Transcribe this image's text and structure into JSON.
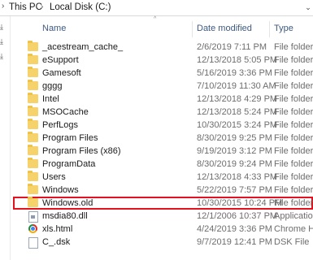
{
  "breadcrumb": {
    "items": [
      "This PC",
      "Local Disk (C:)"
    ]
  },
  "columns": {
    "name": "Name",
    "date": "Date modified",
    "type": "Type"
  },
  "rows": [
    {
      "name": "_acestream_cache_",
      "date": "2/6/2019 7:11 PM",
      "type": "File folder",
      "icon": "folder-icon"
    },
    {
      "name": "eSupport",
      "date": "12/13/2018 5:05 PM",
      "type": "File folder",
      "icon": "folder-icon"
    },
    {
      "name": "Gamesoft",
      "date": "5/16/2019 3:36 PM",
      "type": "File folder",
      "icon": "folder-icon"
    },
    {
      "name": "gggg",
      "date": "7/10/2019 11:30 AM",
      "type": "File folder",
      "icon": "folder-icon"
    },
    {
      "name": "Intel",
      "date": "12/13/2018 4:29 PM",
      "type": "File folder",
      "icon": "folder-icon"
    },
    {
      "name": "MSOCache",
      "date": "12/13/2018 5:24 PM",
      "type": "File folder",
      "icon": "folder-icon"
    },
    {
      "name": "PerfLogs",
      "date": "10/30/2015 3:24 PM",
      "type": "File folder",
      "icon": "folder-icon"
    },
    {
      "name": "Program Files",
      "date": "8/30/2019 9:25 PM",
      "type": "File folder",
      "icon": "folder-icon"
    },
    {
      "name": "Program Files (x86)",
      "date": "9/19/2019 3:12 PM",
      "type": "File folder",
      "icon": "folder-icon"
    },
    {
      "name": "ProgramData",
      "date": "8/30/2019 9:24 PM",
      "type": "File folder",
      "icon": "folder-icon"
    },
    {
      "name": "Users",
      "date": "12/13/2018 4:33 PM",
      "type": "File folder",
      "icon": "folder-icon"
    },
    {
      "name": "Windows",
      "date": "5/22/2019 7:57 PM",
      "type": "File folder",
      "icon": "folder-icon"
    },
    {
      "name": "Windows.old",
      "date": "10/30/2015 10:24 PM",
      "type": "File folder",
      "icon": "folder-icon",
      "highlighted": true
    },
    {
      "name": "msdia80.dll",
      "date": "12/1/2006 10:37 PM",
      "type": "Application",
      "icon": "dll-file-icon"
    },
    {
      "name": "xls.html",
      "date": "4/24/2019 3:36 PM",
      "type": "Chrome HT",
      "icon": "chrome-icon"
    },
    {
      "name": "C_.dsk",
      "date": "9/7/2019 12:41 PM",
      "type": "DSK File",
      "icon": "file-icon"
    }
  ],
  "colors": {
    "highlight_outline": "#e2131f",
    "folder": "#f6d26a",
    "header_text": "#3d5a80"
  }
}
